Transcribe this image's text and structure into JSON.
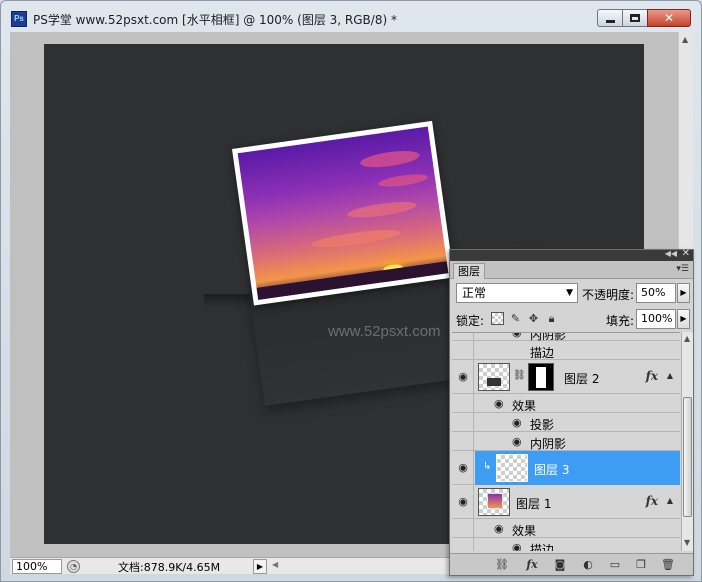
{
  "window": {
    "title": "PS学堂 www.52psxt.com [水平相框] @ 100% (图层 3, RGB/8) *",
    "app_icon_text": "Ps"
  },
  "canvas": {
    "watermark": "www.52psxt.com"
  },
  "statusbar": {
    "zoom": "100%",
    "doc_info": "文档:878.9K/4.65M"
  },
  "layers_panel": {
    "tab_label": "图层",
    "blend_mode": "正常",
    "opacity_label": "不透明度:",
    "opacity_value": "50%",
    "lock_label": "锁定:",
    "fill_label": "填充:",
    "fill_value": "100%",
    "rows": [
      {
        "type": "effect",
        "label": "内阴影",
        "partial": true
      },
      {
        "type": "effect",
        "label": "描边"
      },
      {
        "type": "layer",
        "name": "图层 2",
        "has_mask": true,
        "has_fx": true
      },
      {
        "type": "effects_header",
        "label": "效果"
      },
      {
        "type": "effect",
        "label": "投影"
      },
      {
        "type": "effect",
        "label": "内阴影"
      },
      {
        "type": "layer",
        "name": "图层 3",
        "selected": true,
        "clipped": true
      },
      {
        "type": "layer",
        "name": "图层 1",
        "has_fx": true
      },
      {
        "type": "effects_header",
        "label": "效果"
      },
      {
        "type": "effect",
        "label": "描边"
      }
    ],
    "fx_label": "fx",
    "footer_icons": [
      "link-icon",
      "fx-icon",
      "mask-icon",
      "adjustment-icon",
      "group-icon",
      "new-layer-icon",
      "trash-icon"
    ]
  }
}
